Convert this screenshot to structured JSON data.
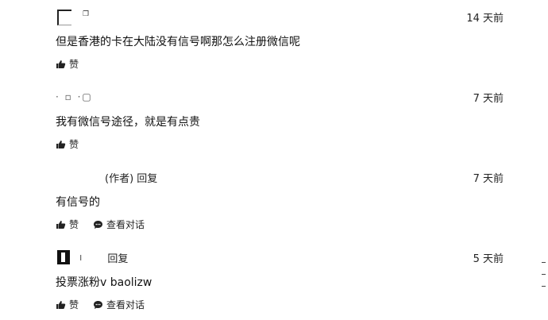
{
  "comments": [
    {
      "time": "14 天前",
      "text": "但是香港的卡在大陆没有信号啊那怎么注册微信呢",
      "like_label": "赞"
    },
    {
      "time": "7 天前",
      "text": "我有微信号途径，就是有点贵",
      "like_label": "赞"
    },
    {
      "role": "(作者) 回复",
      "time": "7 天前",
      "text": "有信号的",
      "like_label": "赞",
      "conversation_label": "查看对话"
    },
    {
      "role": "回复",
      "time": "5 天前",
      "text": "投票涨粉v baolizw",
      "like_label": "赞",
      "conversation_label": "查看对话"
    }
  ],
  "icons": {
    "like": "thumbs-up-icon",
    "conversation": "chat-bubble-icon"
  }
}
